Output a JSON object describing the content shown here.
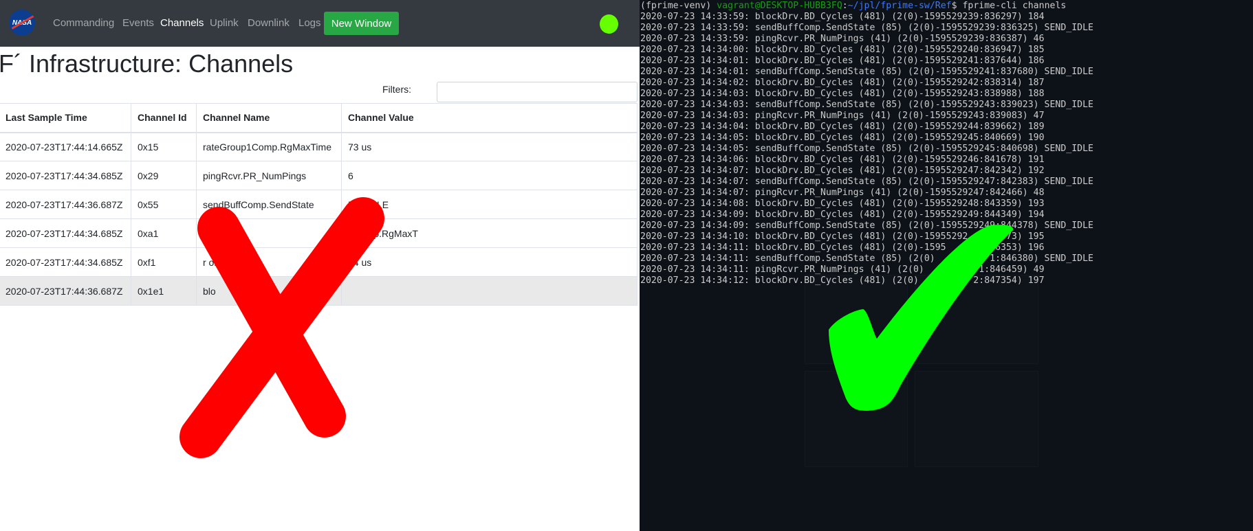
{
  "nav": {
    "logo": "NASA",
    "items": [
      "Commanding",
      "Events",
      "Channels",
      "Uplink",
      "Downlink",
      "Logs"
    ],
    "active": "Channels",
    "new_window": "New Window",
    "status_color": "#66ff00"
  },
  "page": {
    "title": "F´ Infrastructure: Channels",
    "filters_label": "Filters:",
    "filters_value": ""
  },
  "table": {
    "headers": [
      "Last Sample Time",
      "Channel Id",
      "Channel Name",
      "Channel Value"
    ],
    "rows": [
      [
        "2020-07-23T17:44:14.665Z",
        "0x15",
        "rateGroup1Comp.RgMaxTime",
        "73 us"
      ],
      [
        "2020-07-23T17:44:34.685Z",
        "0x29",
        "pingRcvr.PR_NumPings",
        "6"
      ],
      [
        "2020-07-23T17:44:36.687Z",
        "0x55",
        "sendBuffComp.SendState",
        "ND_IDLE"
      ],
      [
        "2020-07-23T17:44:34.685Z",
        "0xa1",
        "",
        "2Comp.RgMaxT"
      ],
      [
        "2020-07-23T17:44:34.685Z",
        "0xf1",
        "r                 omp.Rg",
        "34 us"
      ],
      [
        "2020-07-23T17:44:36.687Z",
        "0x1e1",
        "blo",
        ""
      ]
    ]
  },
  "terminal": {
    "prompt": {
      "env": "(fprime-venv) ",
      "user": "vagrant@DESKTOP-HUBB3FQ",
      "sep": ":",
      "path": "~/jpl/fprime-sw/Ref",
      "cmd": "$ fprime-cli channels"
    },
    "lines": [
      "2020-07-23 14:33:59: blockDrv.BD_Cycles (481) (2(0)-1595529239:836297) 184",
      "2020-07-23 14:33:59: sendBuffComp.SendState (85) (2(0)-1595529239:836325) SEND_IDLE",
      "2020-07-23 14:33:59: pingRcvr.PR_NumPings (41) (2(0)-1595529239:836387) 46",
      "2020-07-23 14:34:00: blockDrv.BD_Cycles (481) (2(0)-1595529240:836947) 185",
      "2020-07-23 14:34:01: blockDrv.BD_Cycles (481) (2(0)-1595529241:837644) 186",
      "2020-07-23 14:34:01: sendBuffComp.SendState (85) (2(0)-1595529241:837680) SEND_IDLE",
      "2020-07-23 14:34:02: blockDrv.BD_Cycles (481) (2(0)-1595529242:838314) 187",
      "2020-07-23 14:34:03: blockDrv.BD_Cycles (481) (2(0)-1595529243:838988) 188",
      "2020-07-23 14:34:03: sendBuffComp.SendState (85) (2(0)-1595529243:839023) SEND_IDLE",
      "2020-07-23 14:34:03: pingRcvr.PR_NumPings (41) (2(0)-1595529243:839083) 47",
      "2020-07-23 14:34:04: blockDrv.BD_Cycles (481) (2(0)-1595529244:839662) 189",
      "2020-07-23 14:34:05: blockDrv.BD_Cycles (481) (2(0)-1595529245:840669) 190",
      "2020-07-23 14:34:05: sendBuffComp.SendState (85) (2(0)-1595529245:840698) SEND_IDLE",
      "2020-07-23 14:34:06: blockDrv.BD_Cycles (481) (2(0)-1595529246:841678) 191",
      "2020-07-23 14:34:07: blockDrv.BD_Cycles (481) (2(0)-1595529247:842342) 192",
      "2020-07-23 14:34:07: sendBuffComp.SendState (85) (2(0)-1595529247:842383) SEND_IDLE",
      "2020-07-23 14:34:07: pingRcvr.PR_NumPings (41) (2(0)-1595529247:842466) 48",
      "2020-07-23 14:34:08: blockDrv.BD_Cycles (481) (2(0)-1595529248:843359) 193",
      "2020-07-23 14:34:09: blockDrv.BD_Cycles (481) (2(0)-1595529249:844349) 194",
      "2020-07-23 14:34:09: sendBuffComp.SendState (85) (2(0)-1595529249:844378) SEND_IDLE",
      "2020-07-23 14:34:10: blockDrv.BD_Cycles (481) (2(0)-15955292  :8  373) 195",
      "2020-07-23 14:34:11: blockDrv.BD_Cycles (481) (2(0)-1595      :846353) 196",
      "2020-07-23 14:34:11: sendBuffComp.SendState (85) (2(0)          1:846380) SEND_IDLE",
      "2020-07-23 14:34:11: pingRcvr.PR_NumPings (41) (2(0)          1:846459) 49",
      "2020-07-23 14:34:12: blockDrv.BD_Cycles (481) (2(0)          2:847354) 197"
    ]
  },
  "overlay": {
    "cross_color": "#ff0000",
    "check_color": "#00ff00"
  }
}
